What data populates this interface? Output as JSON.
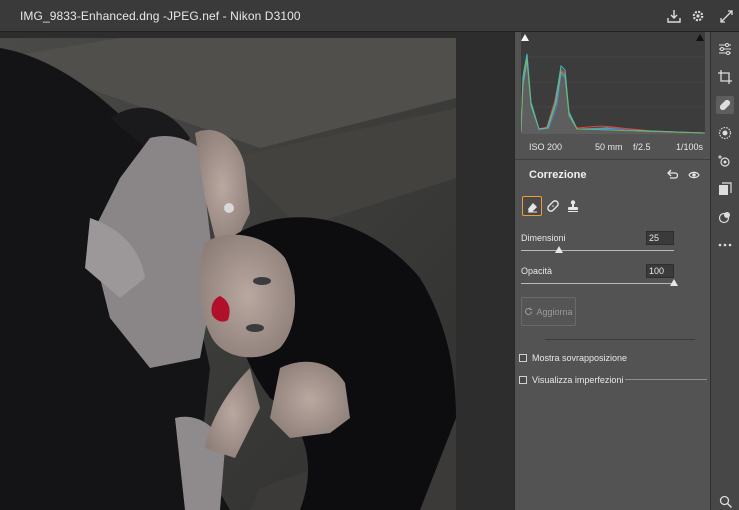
{
  "window": {
    "title": "IMG_9833-Enhanced.dng -JPEG.nef  -  Nikon D3100"
  },
  "histogram": {
    "exif": {
      "iso": "ISO 200",
      "focal": "50 mm",
      "aperture": "f/2.5",
      "shutter": "1/100s"
    }
  },
  "panel": {
    "title": "Correzione",
    "tools": [
      "spot-removal-eraser",
      "healing-bandage",
      "clone-stamp"
    ],
    "size_label": "Dimensioni",
    "size_value": "25",
    "size_level": 0.25,
    "opacity_label": "Opacità",
    "opacity_value": "100",
    "opacity_level": 1.0,
    "refresh_label": "Aggiorna",
    "overlay_label": "Mostra sovrapposizione",
    "visualize_label": "Visualizza imperfezioni"
  },
  "toolbar": {
    "items": [
      "edit-sliders",
      "crop",
      "healing",
      "masking",
      "red-eye",
      "presets",
      "snapshots",
      "more",
      "zoom"
    ]
  },
  "colors": {
    "accent": "#f09b3a",
    "panel": "#535353",
    "titlebar": "#3a3a3a"
  }
}
